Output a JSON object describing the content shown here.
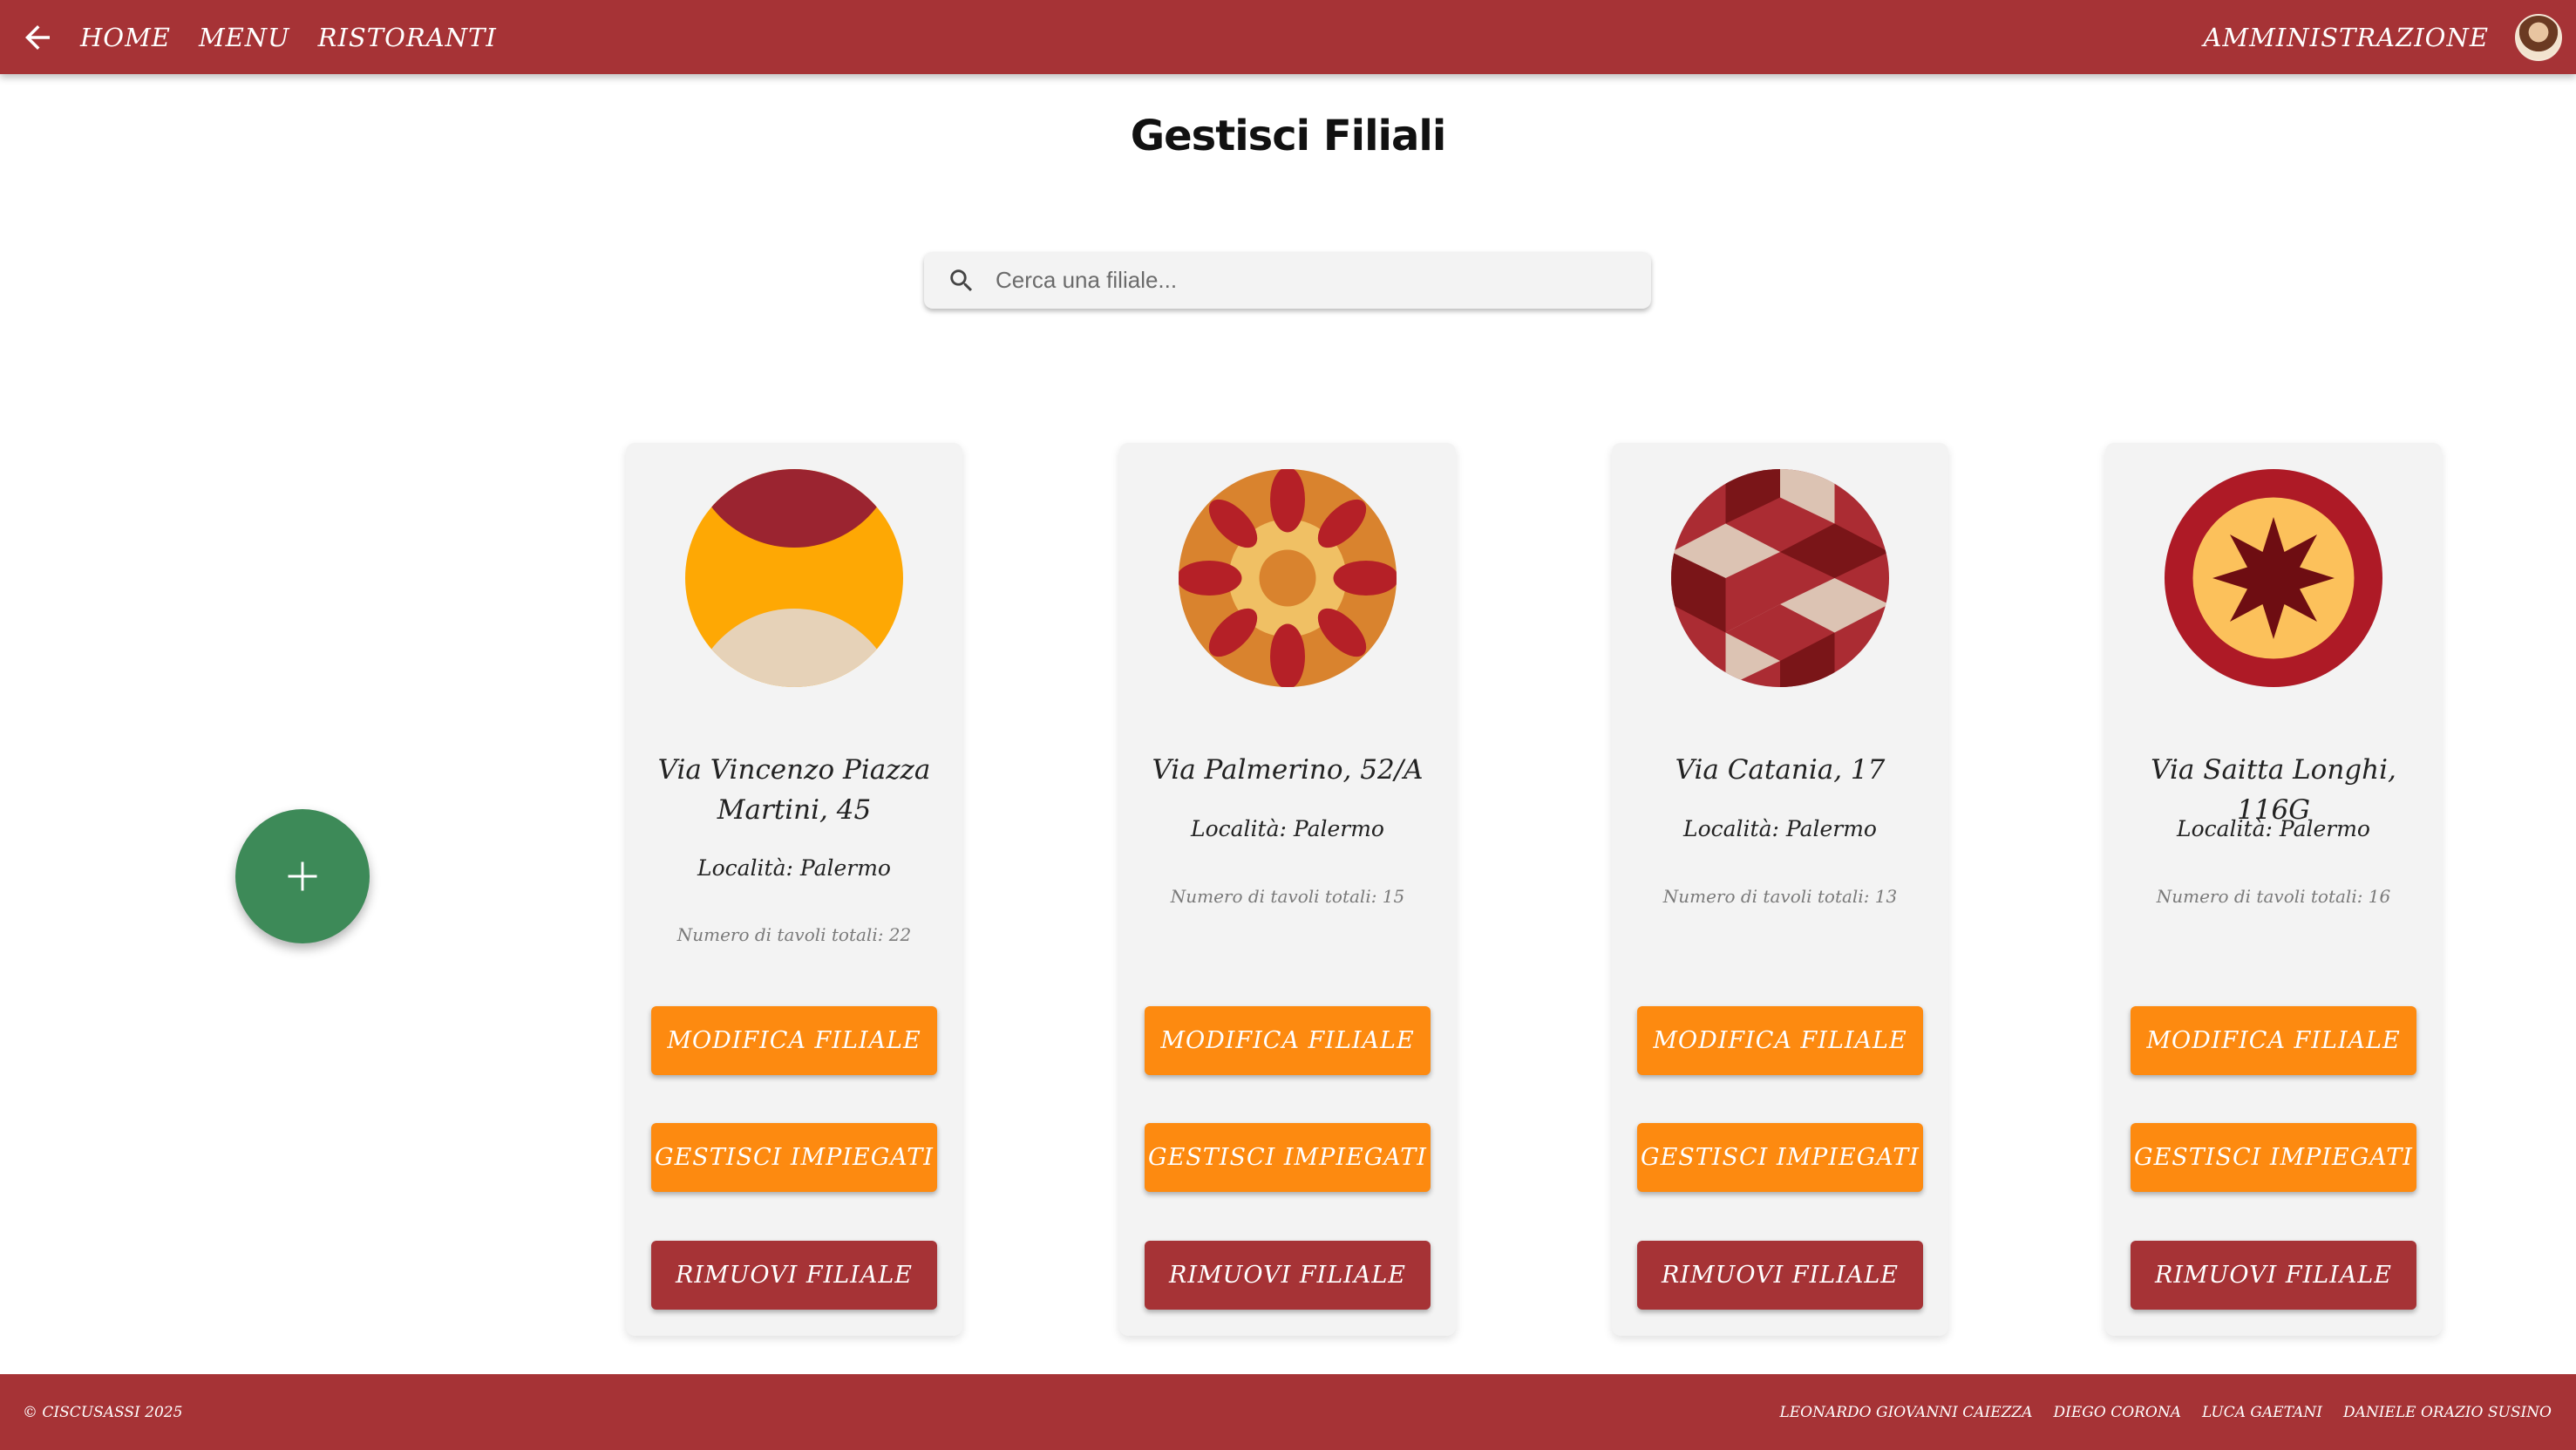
{
  "navbar": {
    "links": [
      {
        "label": "HOME"
      },
      {
        "label": "MENU"
      },
      {
        "label": "RISTORANTI"
      }
    ],
    "admin_label": "AMMINISTRAZIONE"
  },
  "page": {
    "title": "Gestisci Filiali"
  },
  "search": {
    "placeholder": "Cerca una filiale..."
  },
  "branches": [
    {
      "address": "Via Vincenzo Piazza Martini, 45",
      "city": "Località: Palermo",
      "tables": "Numero di tavoli totali: 22",
      "edit_label": "MODIFICA FILIALE",
      "staff_label": "GESTISCI IMPIEGATI",
      "remove_label": "RIMUOVI FILIALE"
    },
    {
      "address": "Via Palmerino, 52/A",
      "city": "Località: Palermo",
      "tables": "Numero di tavoli totali: 15",
      "edit_label": "MODIFICA FILIALE",
      "staff_label": "GESTISCI IMPIEGATI",
      "remove_label": "RIMUOVI FILIALE"
    },
    {
      "address": "Via Catania, 17",
      "city": "Località: Palermo",
      "tables": "Numero di tavoli totali: 13",
      "edit_label": "MODIFICA FILIALE",
      "staff_label": "GESTISCI IMPIEGATI",
      "remove_label": "RIMUOVI FILIALE"
    },
    {
      "address": "Via Saitta Longhi, 116G",
      "city": "Località: Palermo",
      "tables": "Numero di tavoli totali: 16",
      "edit_label": "MODIFICA FILIALE",
      "staff_label": "GESTISCI IMPIEGATI",
      "remove_label": "RIMUOVI FILIALE"
    }
  ],
  "footer": {
    "copyright": "© CISCUSASSI 2025",
    "authors": [
      "LEONARDO GIOVANNI CAIEZZA",
      "DIEGO CORONA",
      "LUCA GAETANI",
      "DANIELE ORAZIO SUSINO"
    ]
  },
  "colors": {
    "brand": "#a63336",
    "accent_orange": "#fd8a10",
    "fab_green": "#3d8a58"
  },
  "icons": {
    "back": "arrow-left-icon",
    "search": "search-icon",
    "add": "plus-icon"
  }
}
